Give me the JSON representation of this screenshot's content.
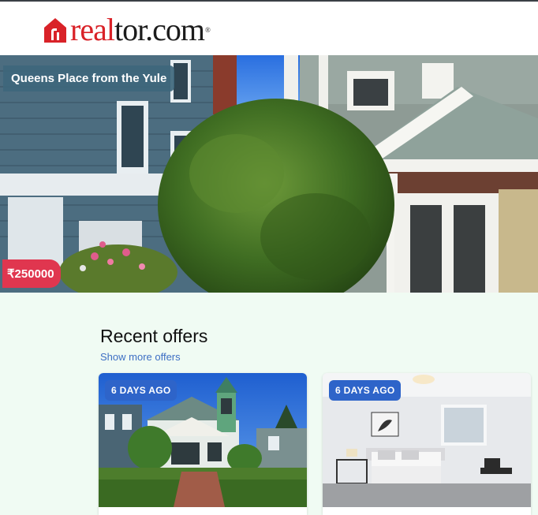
{
  "brand": {
    "name_part1": "real",
    "name_part2": "tor.com",
    "registered": "®",
    "logo_color": "#d92228"
  },
  "hero": {
    "title": "Queens Place from the Yule",
    "price": "₹250000",
    "title_bg": "#3e677c",
    "price_bg": "#e0364f"
  },
  "recent": {
    "title": "Recent offers",
    "show_more": "Show more offers",
    "cards": [
      {
        "badge": "6 DAYS AGO",
        "image": "victorian-house-photo"
      },
      {
        "badge": "6 DAYS AGO",
        "image": "bedroom-photo"
      }
    ]
  },
  "colors": {
    "page_bg": "#f0fbf3",
    "badge_bg": "#2e64c9",
    "link": "#3d6fc4"
  }
}
